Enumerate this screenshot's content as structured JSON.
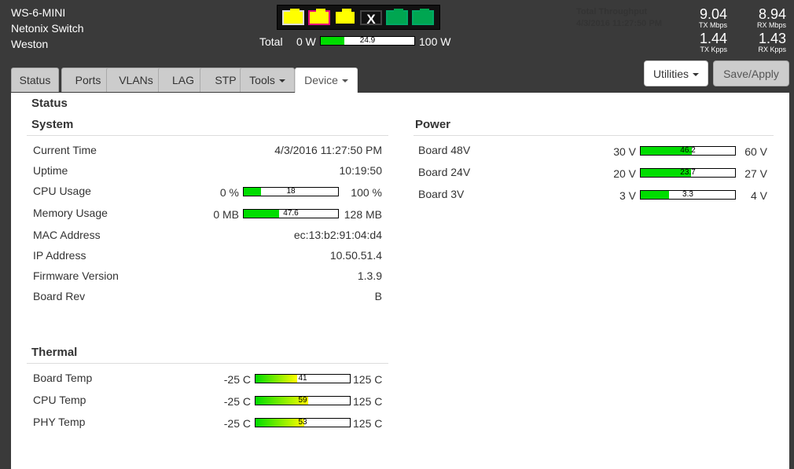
{
  "device": {
    "model": "WS-6-MINI",
    "name": "Netonix Switch",
    "location": "Weston"
  },
  "ports": [
    {
      "status": "yellow",
      "color": "#ffff00"
    },
    {
      "status": "pink",
      "color": "#e5007e"
    },
    {
      "status": "yellow",
      "color": "#ffff00"
    },
    {
      "status": "disabled",
      "label": "X"
    },
    {
      "status": "green",
      "color": "#00a651"
    },
    {
      "status": "green",
      "color": "#00a651"
    }
  ],
  "total_power": {
    "label": "Total",
    "min": "0 W",
    "value": "24.9",
    "fraction": 0.249,
    "max": "100 W"
  },
  "throughput": {
    "title": "Total Throughput",
    "time": "4/3/2016 11:27:50 PM",
    "tx_mbps": "9.04",
    "tx_mbps_unit": "TX Mbps",
    "rx_mbps": "8.94",
    "rx_mbps_unit": "RX Mbps",
    "tx_kpps": "1.44",
    "tx_kpps_unit": "TX Kpps",
    "rx_kpps": "1.43",
    "rx_kpps_unit": "RX Kpps"
  },
  "tabs": [
    "Status",
    "Ports",
    "VLANs",
    "LAG",
    "STP",
    "Tools",
    "Device"
  ],
  "buttons": {
    "utilities": "Utilities",
    "save_apply": "Save/Apply"
  },
  "page_title": "Status",
  "system": {
    "title": "System",
    "current_time_label": "Current Time",
    "current_time": "4/3/2016 11:27:50 PM",
    "uptime_label": "Uptime",
    "uptime": "10:19:50",
    "cpu_label": "CPU Usage",
    "cpu_min": "0 %",
    "cpu_value": "18",
    "cpu_fraction": 0.18,
    "cpu_max": "100 %",
    "mem_label": "Memory Usage",
    "mem_min": "0 MB",
    "mem_value": "47.6",
    "mem_fraction": 0.372,
    "mem_max": "128 MB",
    "mac_label": "MAC Address",
    "mac": "ec:13:b2:91:04:d4",
    "ip_label": "IP Address",
    "ip": "10.50.51.4",
    "fw_label": "Firmware Version",
    "fw": "1.3.9",
    "rev_label": "Board Rev",
    "rev": "B"
  },
  "power": {
    "title": "Power",
    "rows": [
      {
        "label": "Board 48V",
        "min": "30 V",
        "value": "46.2",
        "fraction": 0.54,
        "max": "60 V"
      },
      {
        "label": "Board 24V",
        "min": "20 V",
        "value": "23.7",
        "fraction": 0.53,
        "max": "27 V"
      },
      {
        "label": "Board 3V",
        "min": "3 V",
        "value": "3.3",
        "fraction": 0.3,
        "max": "4 V"
      }
    ]
  },
  "thermal": {
    "title": "Thermal",
    "rows": [
      {
        "label": "Board Temp",
        "min": "-25 C",
        "value": "41",
        "fraction": 0.44,
        "max": "125 C"
      },
      {
        "label": "CPU Temp",
        "min": "-25 C",
        "value": "59",
        "fraction": 0.56,
        "max": "125 C"
      },
      {
        "label": "PHY Temp",
        "min": "-25 C",
        "value": "53",
        "fraction": 0.52,
        "max": "125 C"
      }
    ]
  },
  "colors": {
    "meter_green": "#00dd00",
    "thermal_gradient_start": "#00dd00",
    "thermal_gradient_end": "#ffff00"
  }
}
